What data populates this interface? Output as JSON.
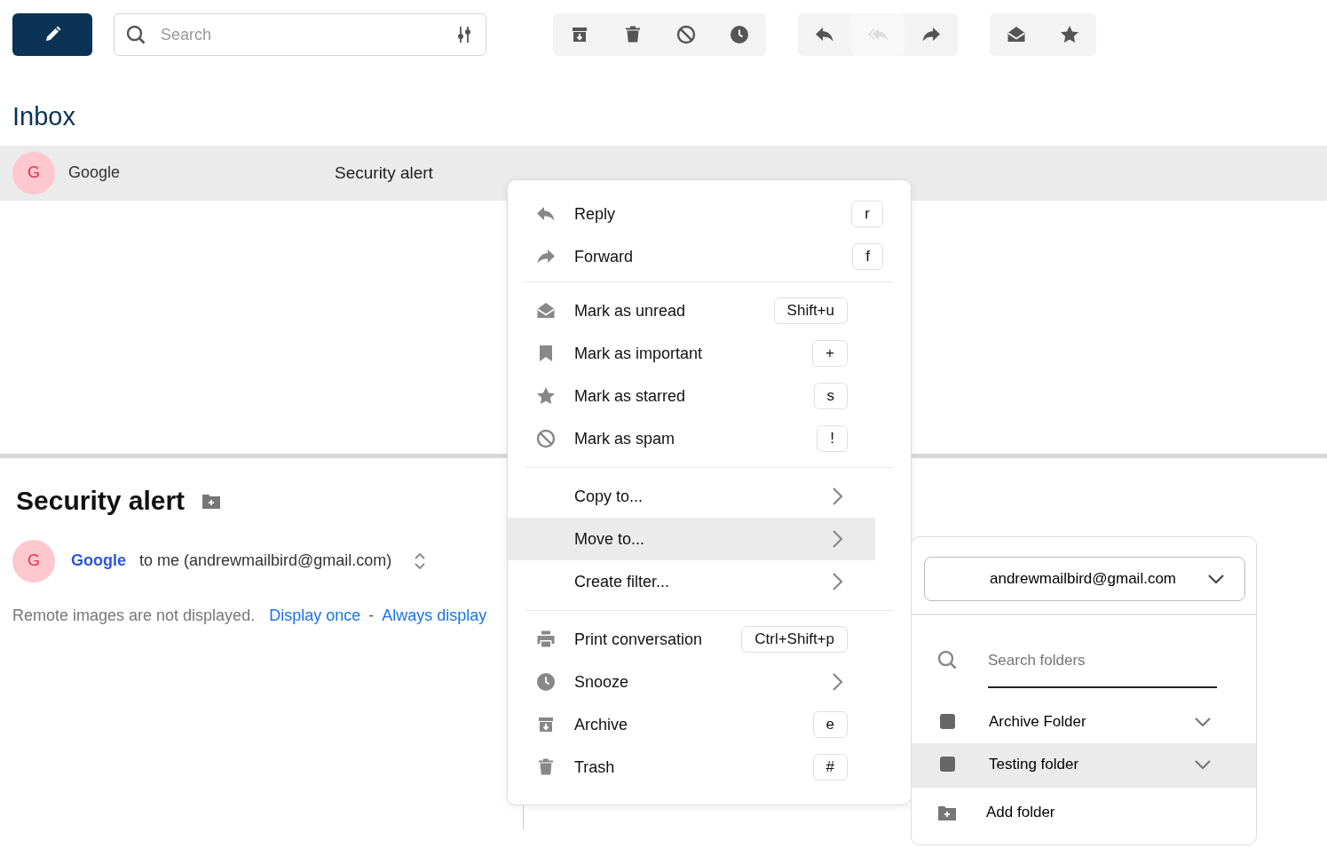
{
  "search": {
    "placeholder": "Search"
  },
  "toolbar_groups": [
    [
      {
        "kind": "archive",
        "disabled": false
      },
      {
        "kind": "trash",
        "disabled": false
      },
      {
        "kind": "spam",
        "disabled": false
      },
      {
        "kind": "snooze",
        "disabled": false
      }
    ],
    [
      {
        "kind": "reply",
        "disabled": false
      },
      {
        "kind": "reply_all",
        "disabled": true
      },
      {
        "kind": "forward",
        "disabled": false
      }
    ],
    [
      {
        "kind": "read",
        "disabled": false
      },
      {
        "kind": "star",
        "disabled": false
      }
    ]
  ],
  "folder_title": "Inbox",
  "messages": [
    {
      "avatar": "G",
      "sender": "Google",
      "subject": "Security alert",
      "selected": true
    }
  ],
  "reading_pane": {
    "subject": "Security alert",
    "avatar": "G",
    "sender": "Google",
    "recipient": "to me (andrewmailbird@gmail.com)",
    "notice": "Remote images are not displayed.",
    "links": [
      "Display once",
      "Always display"
    ],
    "link_separator": "-"
  },
  "context_menu": {
    "sections": [
      [
        {
          "kind": "reply",
          "label": "Reply",
          "shortcut": "r",
          "selected": false
        },
        {
          "kind": "forward",
          "label": "Forward",
          "shortcut": "f",
          "selected": false
        }
      ],
      [
        {
          "kind": "read",
          "label": "Mark as unread",
          "shortcut": "Shift+u",
          "selected": false
        },
        {
          "kind": "bookmark",
          "label": "Mark as important",
          "shortcut": "+",
          "selected": false
        },
        {
          "kind": "star",
          "label": "Mark as starred",
          "shortcut": "s",
          "selected": false
        },
        {
          "kind": "spam",
          "label": "Mark as spam",
          "shortcut": "!",
          "selected": false
        }
      ],
      [
        {
          "kind": "submenu",
          "label": "Copy to...",
          "selected": false
        },
        {
          "kind": "submenu",
          "label": "Move to...",
          "selected": true
        },
        {
          "kind": "submenu",
          "label": "Create filter...",
          "selected": false
        }
      ],
      [
        {
          "kind": "print",
          "label": "Print conversation",
          "shortcut": "Ctrl+Shift+p",
          "selected": false
        },
        {
          "kind": "snooze",
          "label": "Snooze",
          "submenu": true,
          "selected": false
        },
        {
          "kind": "archive",
          "label": "Archive",
          "shortcut": "e",
          "selected": false
        },
        {
          "kind": "trash",
          "label": "Trash",
          "shortcut": "#",
          "selected": false
        }
      ]
    ]
  },
  "move_submenu": {
    "account": "andrewmailbird@gmail.com",
    "search_placeholder": "Search folders",
    "folders": [
      {
        "name": "Archive Folder",
        "selected": false
      },
      {
        "name": "Testing folder",
        "selected": true
      }
    ],
    "add_label": "Add folder"
  }
}
